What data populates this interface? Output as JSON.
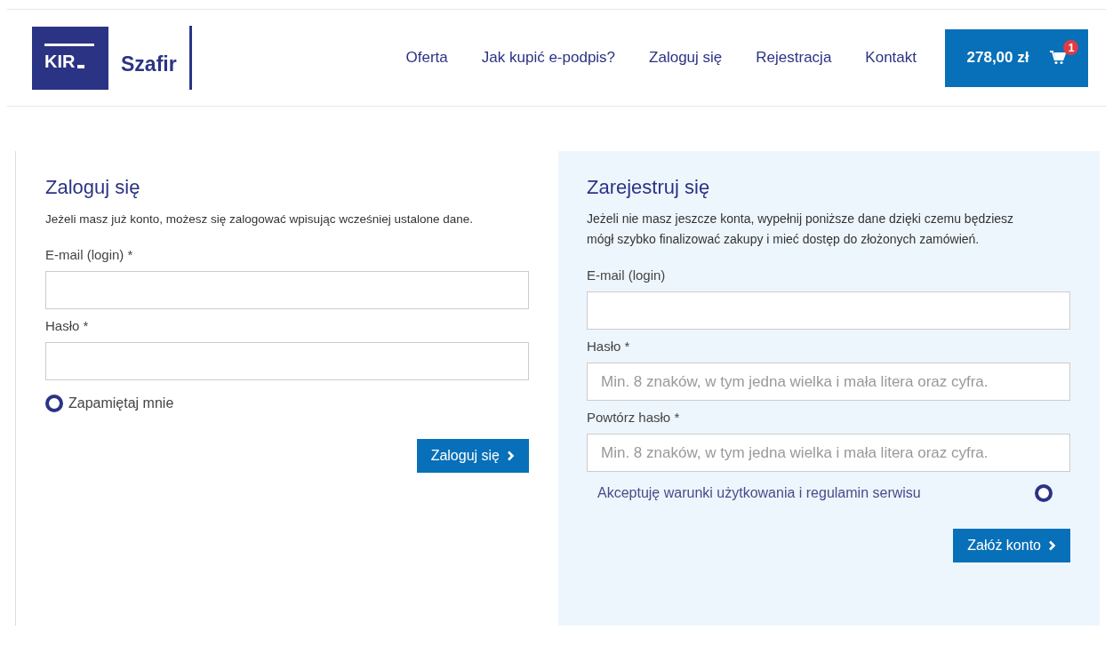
{
  "header": {
    "logo": {
      "mark": "KIR",
      "name": "Szafir"
    },
    "nav": [
      {
        "label": "Oferta"
      },
      {
        "label": "Jak kupić e-podpis?"
      },
      {
        "label": "Zaloguj się"
      },
      {
        "label": "Rejestracja"
      },
      {
        "label": "Kontakt"
      }
    ],
    "cart": {
      "total": "278,00 zł",
      "count": "1"
    }
  },
  "login": {
    "title": "Zaloguj się",
    "intro": "Jeżeli masz już konto, możesz się zalogować wpisując wcześniej ustalone dane.",
    "fields": [
      {
        "label": "E-mail (login) *"
      },
      {
        "label": "Hasło *"
      }
    ],
    "remember": {
      "label": "Zapamiętaj mnie",
      "checked": false
    },
    "button": "Zaloguj się"
  },
  "register": {
    "title": "Zarejestruj się",
    "intro": "Jeżeli nie masz jeszcze konta, wypełnij poniższe dane dzięki czemu będziesz mógł szybko finalizować zakupy i mieć dostęp do złożonych zamówień.",
    "fields": [
      {
        "label": "E-mail (login)"
      },
      {
        "label": "Hasło *",
        "placeholder": "Min. 8 znaków, w tym jedna wielka i mała litera oraz cyfra."
      },
      {
        "label": "Powtórz hasło *",
        "placeholder": "Min. 8 znaków, w tym jedna wielka i mała litera oraz cyfra."
      }
    ],
    "terms": {
      "label": "Akceptuję warunki użytkowania i regulamin serwisu",
      "checked": false
    },
    "button": "Załóż konto"
  }
}
